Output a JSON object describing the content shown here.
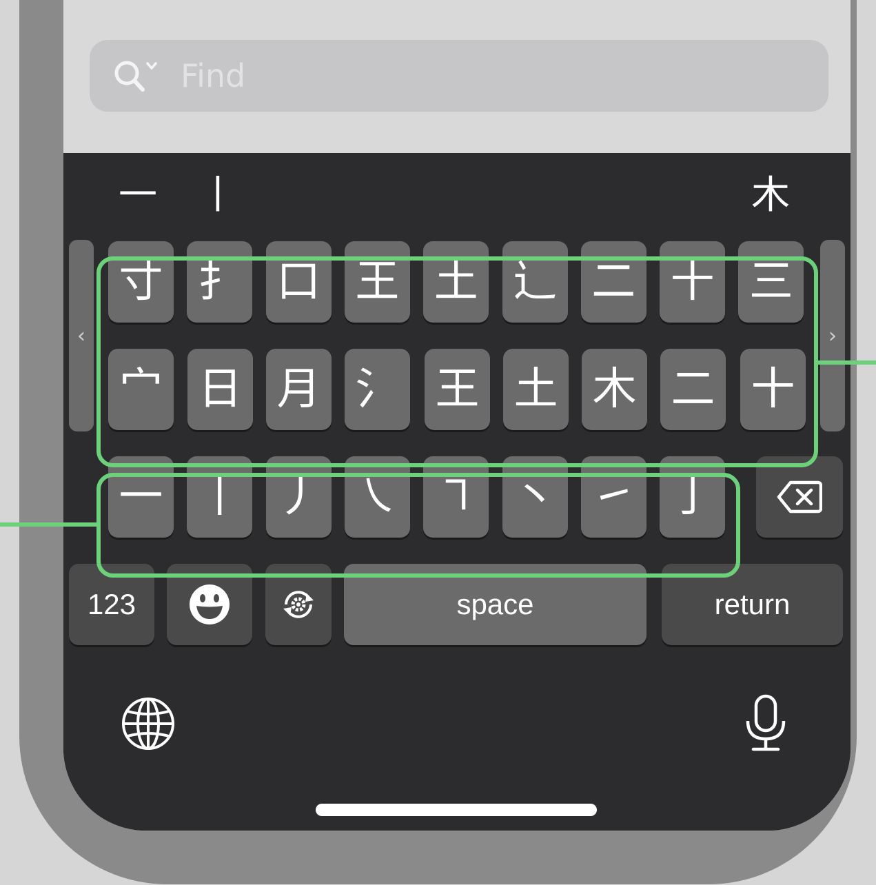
{
  "search": {
    "placeholder": "Find",
    "icon": "search-icon"
  },
  "candidates": {
    "first": "一",
    "second": "丨",
    "third": "木"
  },
  "components_row1": [
    "寸",
    "扌",
    "口",
    "王",
    "土",
    "辶",
    "二",
    "十",
    "三"
  ],
  "components_row2": [
    "宀",
    "日",
    "月",
    "氵",
    "王",
    "土",
    "木",
    "二",
    "十"
  ],
  "strokes": [
    "一",
    "丨",
    "丿",
    "㇏",
    "㇕",
    "丶",
    "㇀",
    "亅"
  ],
  "scroll_left": "‹",
  "scroll_right": "›",
  "bottom_row": {
    "numbers_label": "123",
    "space_label": "space",
    "return_label": "return"
  },
  "icons": [
    "chevron-left-icon",
    "chevron-right-icon",
    "delete-icon",
    "emoji-icon",
    "keyboard-switch-icon",
    "globe-icon",
    "microphone-icon"
  ],
  "colors": {
    "highlight": "#6cd17a",
    "key": "#6b6b6b",
    "key_dark": "#4a4a4a",
    "keyboard_bg": "#2c2c2e",
    "search_bg": "#c6c6c8"
  }
}
